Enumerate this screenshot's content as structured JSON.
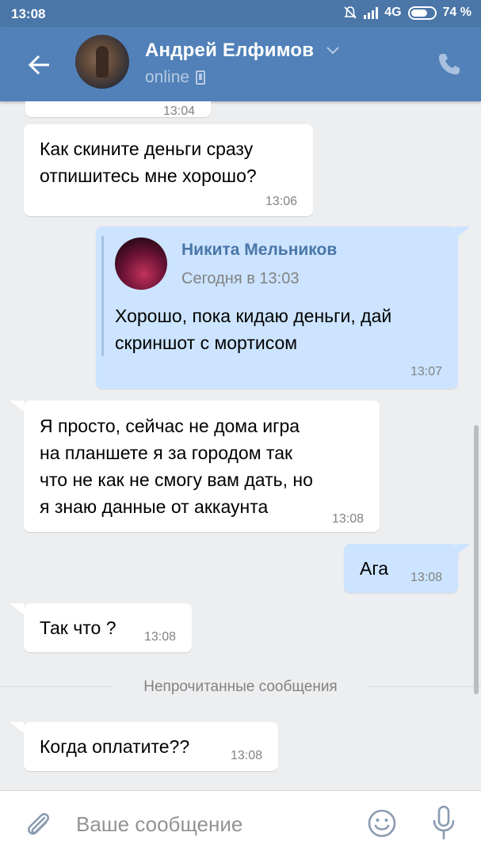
{
  "status_bar": {
    "time": "13:08",
    "network": "4G",
    "battery": "74 %",
    "battery_level": 0.74
  },
  "header": {
    "contact_name": "Андрей Елфимов",
    "status": "online"
  },
  "messages": [
    {
      "direction": "in",
      "text_lines": [
        "Как скините деньги сразу",
        "отпишитесь мне хорошо?"
      ],
      "time": "13:06"
    },
    {
      "direction": "out",
      "forwarded": {
        "author": "Никита Мельников",
        "date": "Сегодня в 13:03",
        "text_lines": [
          "Хорошо, пока кидаю деньги, дай",
          "скриншот с мортисом"
        ]
      },
      "time": "13:07"
    },
    {
      "direction": "in",
      "text_lines": [
        "Я просто, сейчас не дома игра",
        "на планшете я за городом так",
        "что не как не смогу вам дать, но",
        "я знаю данные от аккаунта"
      ],
      "time": "13:08"
    },
    {
      "direction": "out",
      "text": "Ага",
      "time": "13:08"
    },
    {
      "direction": "in",
      "text": "Так что ?",
      "time": "13:08"
    },
    {
      "direction": "in",
      "text": "Когда оплатите??",
      "time": "13:08"
    }
  ],
  "partial_top_time": "13:04",
  "unread_divider": "Непрочитанные сообщения",
  "composer": {
    "placeholder": "Ваше сообщение"
  }
}
